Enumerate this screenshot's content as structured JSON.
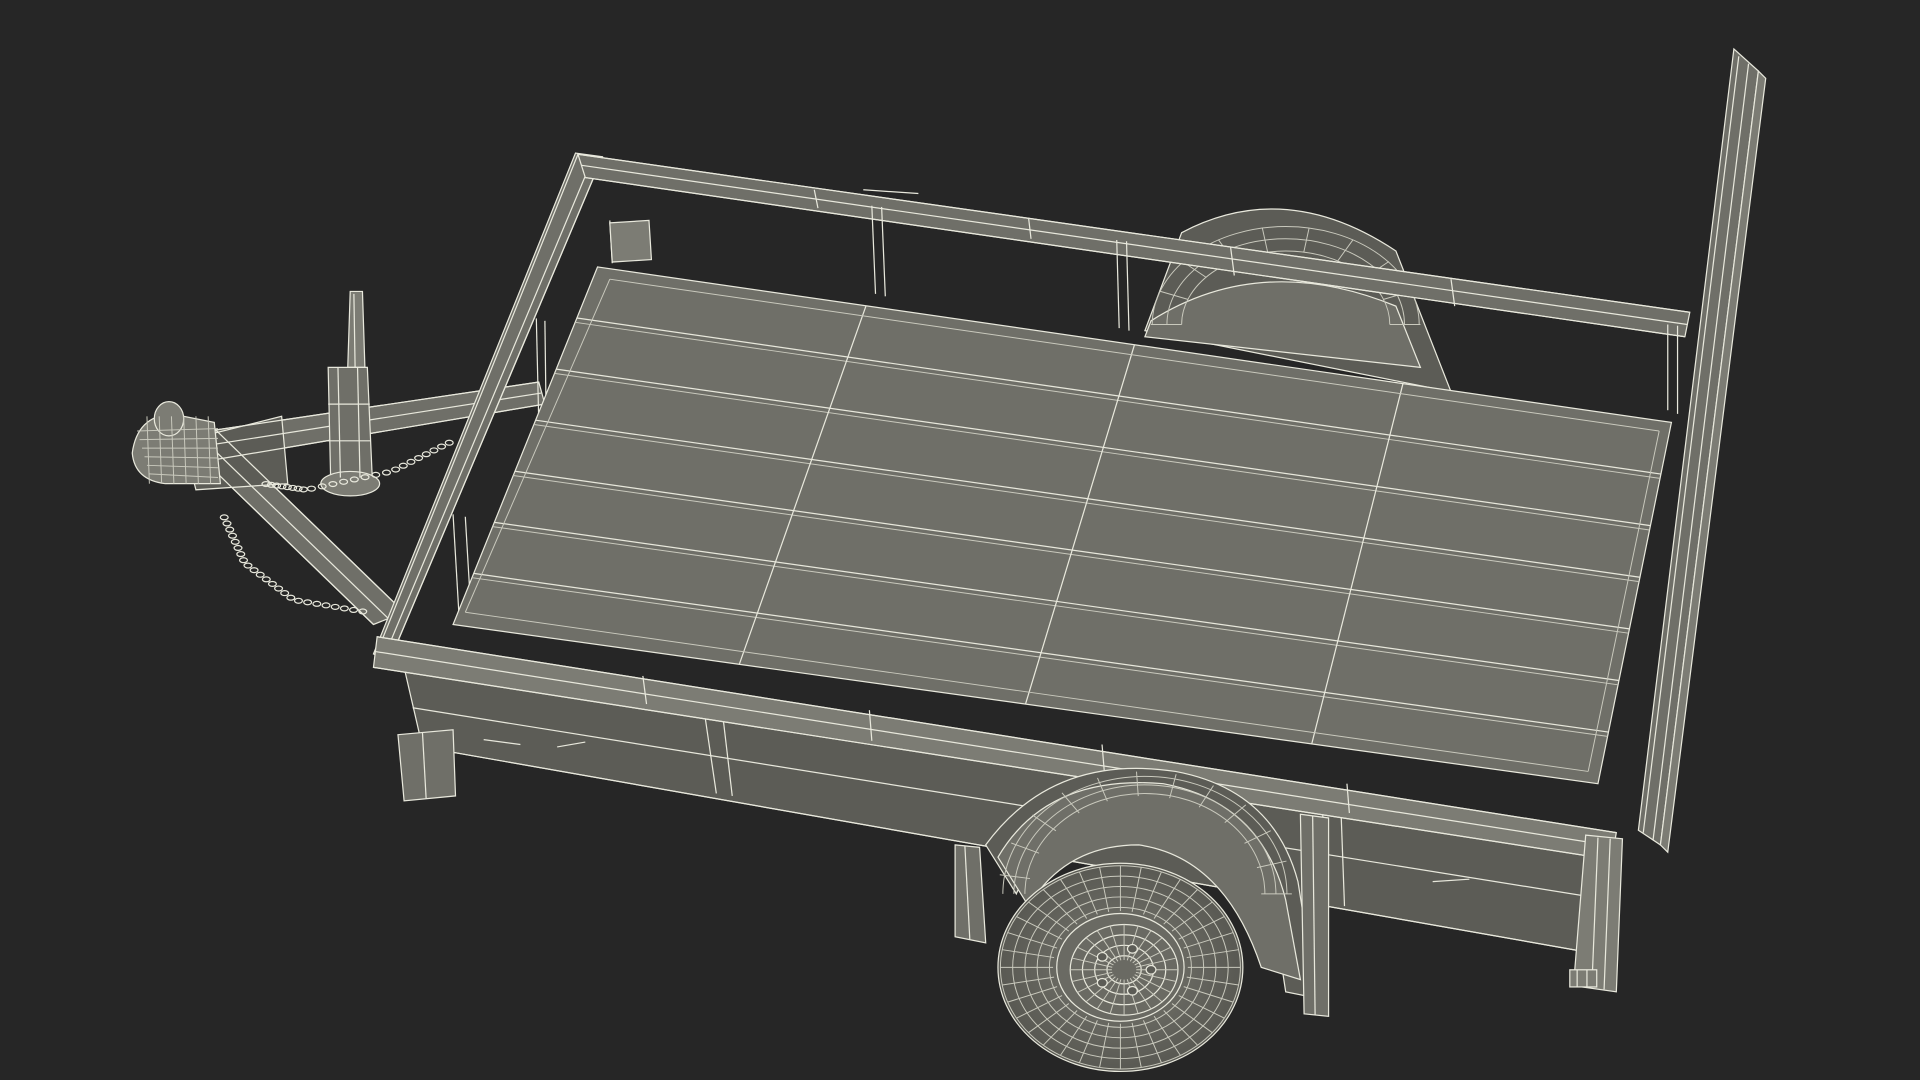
{
  "scene": {
    "subject": "utility-trailer-wireframe",
    "view": "isometric-top",
    "colors": {
      "background": "#262626",
      "surface": "#6f6f68",
      "surface_dark": "#5c5c56",
      "surface_light": "#7c7c74",
      "wire": "#e8e8dc",
      "wire_dim": "#c9c9bd"
    }
  }
}
